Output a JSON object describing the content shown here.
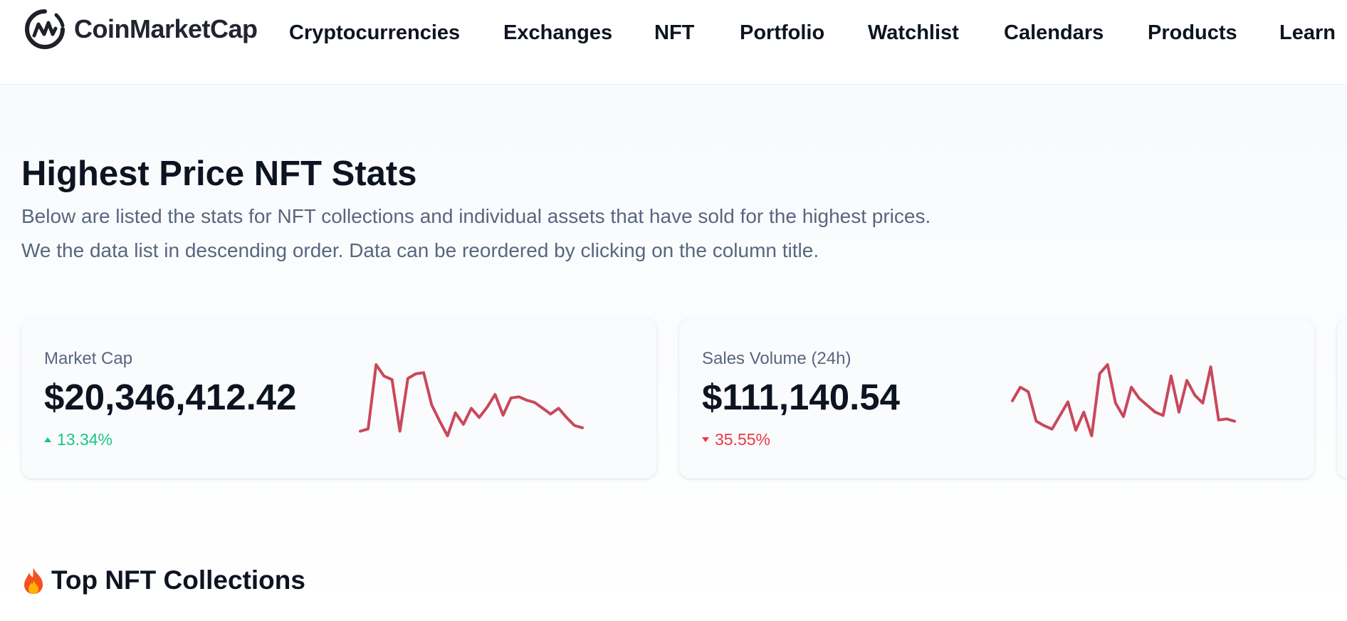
{
  "header": {
    "brand": "CoinMarketCap",
    "nav": [
      {
        "label": "Cryptocurrencies"
      },
      {
        "label": "Exchanges"
      },
      {
        "label": "NFT"
      },
      {
        "label": "Portfolio"
      },
      {
        "label": "Watchlist"
      },
      {
        "label": "Calendars"
      },
      {
        "label": "Products"
      },
      {
        "label": "Learn"
      }
    ]
  },
  "page": {
    "title": "Highest Price NFT Stats",
    "description_line1": "Below are listed the stats for NFT collections and individual assets that have sold for the highest prices.",
    "description_line2": "We the data list in descending order. Data can be reordered by clicking on the column title."
  },
  "stats": [
    {
      "label": "Market Cap",
      "value": "$20,346,412.42",
      "change": "13.34%",
      "direction": "up",
      "change_color": "#16c784",
      "sparkline": [
        40,
        42,
        98,
        88,
        85,
        40,
        86,
        90,
        91,
        63,
        49,
        36,
        56,
        46,
        60,
        52,
        61,
        72,
        54,
        69,
        70,
        67,
        65,
        60,
        55,
        60,
        52,
        45,
        43
      ]
    },
    {
      "label": "Sales Volume (24h)",
      "value": "$111,140.54",
      "change": "35.55%",
      "direction": "down",
      "change_color": "#ea3943",
      "sparkline": [
        68,
        80,
        76,
        50,
        46,
        43,
        55,
        67,
        42,
        58,
        37,
        92,
        100,
        66,
        54,
        80,
        70,
        64,
        58,
        55,
        90,
        58,
        86,
        73,
        66,
        98,
        51,
        52,
        50
      ]
    }
  ],
  "sparkline_color": "#c9485b",
  "section": {
    "icon": "fire-icon",
    "title": "Top NFT Collections"
  }
}
